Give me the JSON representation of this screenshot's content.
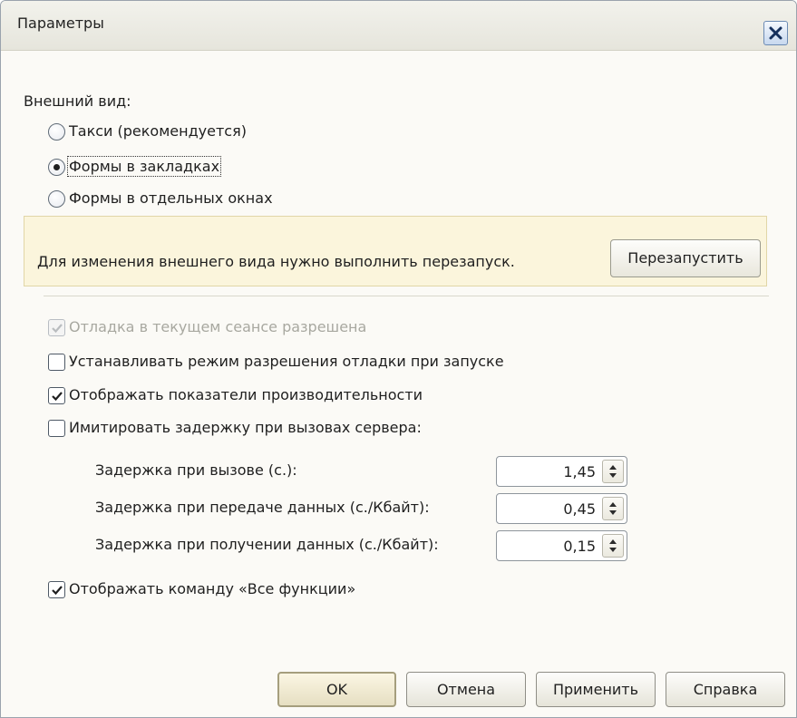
{
  "window": {
    "title": "Параметры"
  },
  "appearance": {
    "label": "Внешний вид:",
    "options": [
      {
        "label": "Такси (рекомендуется)",
        "selected": false
      },
      {
        "label": "Формы в закладках",
        "selected": true
      },
      {
        "label": "Формы в отдельных окнах",
        "selected": false
      }
    ]
  },
  "restart_panel": {
    "message": "Для изменения внешнего вида нужно выполнить перезапуск.",
    "button": "Перезапустить"
  },
  "options": {
    "debug_allowed": {
      "label": "Отладка в текущем сеансе разрешена",
      "checked": true,
      "disabled": true
    },
    "set_debug_mode": {
      "label": "Устанавливать режим разрешения отладки при запуске",
      "checked": false
    },
    "show_performance": {
      "label": "Отображать показатели производительности",
      "checked": true
    },
    "simulate_delay": {
      "label": "Имитировать задержку при вызовах сервера:",
      "checked": false
    },
    "show_all_functions": {
      "label": "Отображать команду «Все функции»",
      "checked": true
    }
  },
  "delays": {
    "call": {
      "label": "Задержка при вызове (с.):",
      "value": "1,45"
    },
    "send": {
      "label": "Задержка при передаче данных (с./Кбайт):",
      "value": "0,45"
    },
    "receive": {
      "label": "Задержка при получении данных (с./Кбайт):",
      "value": "0,15"
    }
  },
  "buttons": {
    "ok": "OK",
    "cancel": "Отмена",
    "apply": "Применить",
    "help": "Справка"
  }
}
